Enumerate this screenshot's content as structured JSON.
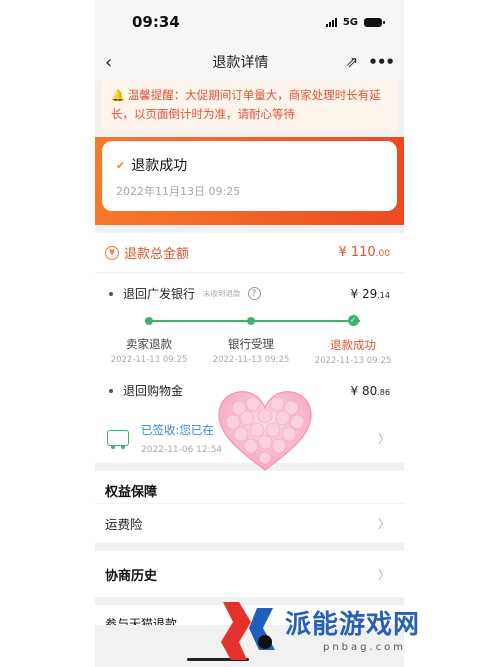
{
  "status_bar": {
    "time": "09:34",
    "network": "5G"
  },
  "nav": {
    "back": "‹",
    "title": "退款详情",
    "share": "⇗",
    "more": "•••"
  },
  "notice": {
    "text": "温馨提醒：大促期间订单量大，商家处理时长有延长，以页面倒计时为准，请耐心等待"
  },
  "status_card": {
    "title": "退款成功",
    "date": "2022年11月13日 09:25"
  },
  "refund_total": {
    "label": "退款总金额",
    "value": "¥ 110",
    "cents": ".00"
  },
  "bank_refund": {
    "label": "退回广发银行",
    "note": "未收到退款",
    "amount": "¥ 29",
    "cents": ".14"
  },
  "progress_steps": [
    {
      "label": "卖家退款",
      "date": "2022-11-13 09:25"
    },
    {
      "label": "银行受理",
      "date": "2022-11-13 09:25"
    },
    {
      "label": "退款成功",
      "date": "2022-11-13 09:25"
    }
  ],
  "gold_refund": {
    "label": "退回购物金",
    "amount": "¥ 80",
    "cents": ".86"
  },
  "delivery": {
    "status": "已签收:您已在",
    "date": "2022-11-06 12:54"
  },
  "rights": {
    "title": "权益保障",
    "item": "运费险"
  },
  "negotiation": {
    "title": "协商历史"
  },
  "partial_section": {
    "text": "参与天猫退款"
  },
  "watermark": {
    "title": "派能游戏网",
    "sub": "pnbag.com"
  },
  "colors": {
    "accent": "#e2562a",
    "orange_band": "#f26a2a",
    "progress_green": "#3fb36b",
    "link_blue": "#3a8ad6"
  }
}
